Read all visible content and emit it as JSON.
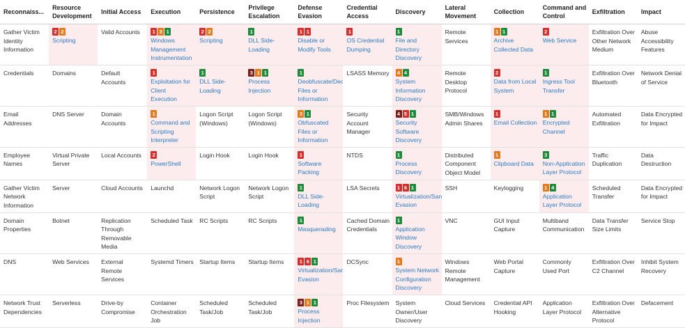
{
  "headers": [
    "Reconnaiss...",
    "Resource Development",
    "Initial Access",
    "Execution",
    "Persistence",
    "Privilege Escalation",
    "Defense Evasion",
    "Credential Access",
    "Discovery",
    "Lateral Movement",
    "Collection",
    "Command and Control",
    "Exfiltration",
    "Impact"
  ],
  "colors": {
    "red": "#d62e2b",
    "orange": "#e27b1d",
    "green": "#1f8a3a",
    "dark_red": "#7a1f19",
    "link": "#2b7bc1",
    "highlight": "#fdecee"
  },
  "rows": [
    [
      {
        "text": "Gather Victim Identity Information"
      },
      {
        "text": "Scripting",
        "link": true,
        "hl": true,
        "badges": [
          {
            "c": "red",
            "n": "2"
          },
          {
            "c": "orange",
            "n": "2"
          }
        ]
      },
      {
        "text": "Valid Accounts"
      },
      {
        "text": "Windows Management Instrumentation",
        "link": true,
        "hl": true,
        "badges": [
          {
            "c": "red",
            "n": "1"
          },
          {
            "c": "orange",
            "n": "3"
          },
          {
            "c": "green",
            "n": "1"
          }
        ]
      },
      {
        "text": "Scripting",
        "link": true,
        "hl": true,
        "badges": [
          {
            "c": "red",
            "n": "2"
          },
          {
            "c": "orange",
            "n": "2"
          }
        ]
      },
      {
        "text": "DLL Side-Loading",
        "link": true,
        "hl": true,
        "badges": [
          {
            "c": "green",
            "n": "1"
          }
        ]
      },
      {
        "text": "Disable or Modify Tools",
        "link": true,
        "hl": true,
        "badges": [
          {
            "c": "red",
            "n": "1"
          },
          {
            "c": "red",
            "n": "1"
          }
        ]
      },
      {
        "text": "OS Credential Dumping",
        "link": true,
        "hl": true,
        "badges": [
          {
            "c": "red",
            "n": "1"
          }
        ]
      },
      {
        "text": "File and Directory Discovery",
        "link": true,
        "hl": true,
        "badges": [
          {
            "c": "green",
            "n": "1"
          }
        ]
      },
      {
        "text": "Remote Services"
      },
      {
        "text": "Archive Collected Data",
        "link": true,
        "hl": true,
        "badges": [
          {
            "c": "orange",
            "n": "1"
          },
          {
            "c": "green",
            "n": "1"
          }
        ]
      },
      {
        "text": "Web Service",
        "link": true,
        "hl": true,
        "badges": [
          {
            "c": "red",
            "n": "2"
          }
        ]
      },
      {
        "text": "Exfiltration Over Other Network Medium"
      },
      {
        "text": "Abuse Accessibility Features"
      }
    ],
    [
      {
        "text": "Credentials"
      },
      {
        "text": "Domains"
      },
      {
        "text": "Default Accounts"
      },
      {
        "text": "Exploitation for Client Execution",
        "link": true,
        "hl": true,
        "badges": [
          {
            "c": "red",
            "n": "1"
          }
        ]
      },
      {
        "text": "DLL Side-Loading",
        "link": true,
        "hl": true,
        "badges": [
          {
            "c": "green",
            "n": "1"
          }
        ]
      },
      {
        "text": "Process Injection",
        "link": true,
        "hl": true,
        "badges": [
          {
            "c": "dkred",
            "n": "3"
          },
          {
            "c": "orange",
            "n": "1"
          },
          {
            "c": "green",
            "n": "1"
          }
        ]
      },
      {
        "text": "Deobfuscate/Decode Files or Information",
        "link": true,
        "hl": true,
        "badges": [
          {
            "c": "green",
            "n": "1"
          }
        ]
      },
      {
        "text": "LSASS Memory"
      },
      {
        "text": "System Information Discovery",
        "link": true,
        "hl": true,
        "badges": [
          {
            "c": "orange",
            "n": "4"
          },
          {
            "c": "green",
            "n": "4"
          }
        ]
      },
      {
        "text": "Remote Desktop Protocol"
      },
      {
        "text": "Data from Local System",
        "link": true,
        "hl": true,
        "badges": [
          {
            "c": "red",
            "n": "2"
          }
        ]
      },
      {
        "text": "Ingress Tool Transfer",
        "link": true,
        "hl": true,
        "badges": [
          {
            "c": "green",
            "n": "1"
          }
        ]
      },
      {
        "text": "Exfiltration Over Bluetooth"
      },
      {
        "text": "Network Denial of Service"
      }
    ],
    [
      {
        "text": "Email Addresses"
      },
      {
        "text": "DNS Server"
      },
      {
        "text": "Domain Accounts"
      },
      {
        "text": "Command and Scripting Interpreter",
        "link": true,
        "hl": true,
        "badges": [
          {
            "c": "orange",
            "n": "1"
          }
        ]
      },
      {
        "text": "Logon Script (Windows)"
      },
      {
        "text": "Logon Script (Windows)"
      },
      {
        "text": "Obfuscated Files or Information",
        "link": true,
        "hl": true,
        "badges": [
          {
            "c": "orange",
            "n": "3"
          },
          {
            "c": "green",
            "n": "1"
          }
        ]
      },
      {
        "text": "Security Account Manager"
      },
      {
        "text": "Security Software Discovery",
        "link": true,
        "hl": true,
        "badges": [
          {
            "c": "dkred",
            "n": "4"
          },
          {
            "c": "red",
            "n": "5"
          },
          {
            "c": "green",
            "n": "1"
          }
        ]
      },
      {
        "text": "SMB/Windows Admin Shares"
      },
      {
        "text": "Email Collection",
        "link": true,
        "hl": true,
        "badges": [
          {
            "c": "red",
            "n": "1"
          }
        ]
      },
      {
        "text": "Encrypted Channel",
        "link": true,
        "hl": true,
        "badges": [
          {
            "c": "orange",
            "n": "1"
          },
          {
            "c": "green",
            "n": "1"
          }
        ]
      },
      {
        "text": "Automated Exfiltration"
      },
      {
        "text": "Data Encrypted for Impact"
      }
    ],
    [
      {
        "text": "Employee Names"
      },
      {
        "text": "Virtual Private Server"
      },
      {
        "text": "Local Accounts"
      },
      {
        "text": "PowerShell",
        "link": true,
        "hl": true,
        "badges": [
          {
            "c": "red",
            "n": "2"
          }
        ]
      },
      {
        "text": "Login Hook"
      },
      {
        "text": "Login Hook"
      },
      {
        "text": "Software Packing",
        "link": true,
        "hl": true,
        "badges": [
          {
            "c": "red",
            "n": "1"
          }
        ]
      },
      {
        "text": "NTDS"
      },
      {
        "text": "Process Discovery",
        "link": true,
        "hl": true,
        "badges": [
          {
            "c": "green",
            "n": "1"
          }
        ]
      },
      {
        "text": "Distributed Component Object Model"
      },
      {
        "text": "Clipboard Data",
        "link": true,
        "hl": true,
        "badges": [
          {
            "c": "orange",
            "n": "1"
          }
        ]
      },
      {
        "text": "Non-Application Layer Protocol",
        "link": true,
        "hl": true,
        "badges": [
          {
            "c": "green",
            "n": "3"
          }
        ]
      },
      {
        "text": "Traffic Duplication"
      },
      {
        "text": "Data Destruction"
      }
    ],
    [
      {
        "text": "Gather Victim Network Information"
      },
      {
        "text": "Server"
      },
      {
        "text": "Cloud Accounts"
      },
      {
        "text": "Launchd"
      },
      {
        "text": "Network Logon Script"
      },
      {
        "text": "Network Logon Script"
      },
      {
        "text": "DLL Side-Loading",
        "link": true,
        "hl": true,
        "badges": [
          {
            "c": "green",
            "n": "1"
          }
        ]
      },
      {
        "text": "LSA Secrets"
      },
      {
        "text": "Virtualization/Sandbox Evasion",
        "link": true,
        "hl": true,
        "badges": [
          {
            "c": "red",
            "n": "1"
          },
          {
            "c": "red",
            "n": "6"
          },
          {
            "c": "green",
            "n": "1"
          }
        ]
      },
      {
        "text": "SSH"
      },
      {
        "text": "Keylogging"
      },
      {
        "text": "Application Layer Protocol",
        "link": true,
        "hl": true,
        "badges": [
          {
            "c": "orange",
            "n": "1"
          },
          {
            "c": "green",
            "n": "4"
          }
        ]
      },
      {
        "text": "Scheduled Transfer"
      },
      {
        "text": "Data Encrypted for Impact"
      }
    ],
    [
      {
        "text": "Domain Properties"
      },
      {
        "text": "Botnet"
      },
      {
        "text": "Replication Through Removable Media"
      },
      {
        "text": "Scheduled Task"
      },
      {
        "text": "RC Scripts"
      },
      {
        "text": "RC Scripts"
      },
      {
        "text": "Masquerading",
        "link": true,
        "hl": true,
        "badges": [
          {
            "c": "green",
            "n": "1"
          }
        ]
      },
      {
        "text": "Cached Domain Credentials"
      },
      {
        "text": "Application Window Discovery",
        "link": true,
        "hl": true,
        "badges": [
          {
            "c": "green",
            "n": "1"
          }
        ]
      },
      {
        "text": "VNC"
      },
      {
        "text": "GUI Input Capture"
      },
      {
        "text": "Multiband Communication"
      },
      {
        "text": "Data Transfer Size Limits"
      },
      {
        "text": "Service Stop"
      }
    ],
    [
      {
        "text": "DNS"
      },
      {
        "text": "Web Services"
      },
      {
        "text": "External Remote Services"
      },
      {
        "text": "Systemd Timers"
      },
      {
        "text": "Startup Items"
      },
      {
        "text": "Startup Items"
      },
      {
        "text": "Virtualization/Sandbox Evasion",
        "link": true,
        "hl": true,
        "badges": [
          {
            "c": "red",
            "n": "1"
          },
          {
            "c": "red",
            "n": "6"
          },
          {
            "c": "green",
            "n": "1"
          }
        ]
      },
      {
        "text": "DCSync"
      },
      {
        "text": "System Network Configuration Discovery",
        "link": true,
        "hl": true,
        "badges": [
          {
            "c": "orange",
            "n": "1"
          }
        ]
      },
      {
        "text": "Windows Remote Management"
      },
      {
        "text": "Web Portal Capture"
      },
      {
        "text": "Commonly Used Port"
      },
      {
        "text": "Exfiltration Over C2 Channel"
      },
      {
        "text": "Inhibit System Recovery"
      }
    ],
    [
      {
        "text": "Network Trust Dependencies"
      },
      {
        "text": "Serverless"
      },
      {
        "text": "Drive-by Compromise"
      },
      {
        "text": "Container Orchestration Job"
      },
      {
        "text": "Scheduled Task/Job"
      },
      {
        "text": "Scheduled Task/Job"
      },
      {
        "text": "Process Injection",
        "link": true,
        "hl": true,
        "badges": [
          {
            "c": "dkred",
            "n": "3"
          },
          {
            "c": "orange",
            "n": "1"
          },
          {
            "c": "green",
            "n": "1"
          }
        ]
      },
      {
        "text": "Proc Filesystem"
      },
      {
        "text": "System Owner/User Discovery"
      },
      {
        "text": "Cloud Services"
      },
      {
        "text": "Credential API Hooking"
      },
      {
        "text": "Application Layer Protocol"
      },
      {
        "text": "Exfiltration Over Alternative Protocol"
      },
      {
        "text": "Defacement"
      }
    ]
  ]
}
